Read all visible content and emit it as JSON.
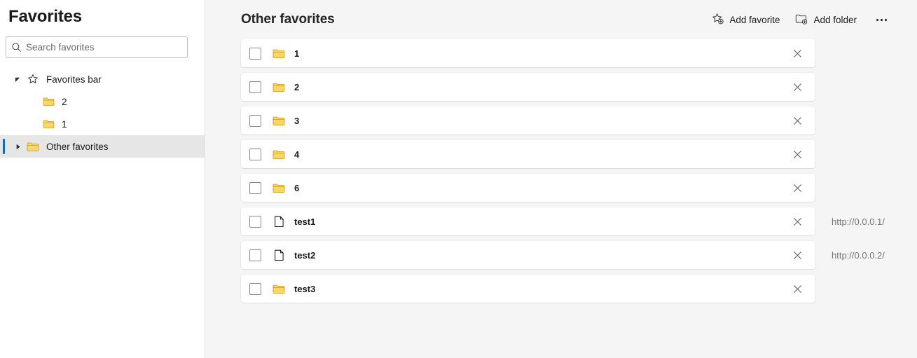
{
  "sidebar": {
    "title": "Favorites",
    "search": {
      "placeholder": "Search favorites",
      "value": "",
      "icon": "search-icon"
    },
    "tree": [
      {
        "label": "Favorites bar",
        "icon": "star-icon",
        "twisty": "expanded",
        "level": 0,
        "selected": false
      },
      {
        "label": "2",
        "icon": "folder-icon",
        "twisty": "none",
        "level": 1,
        "selected": false
      },
      {
        "label": "1",
        "icon": "folder-icon",
        "twisty": "none",
        "level": 1,
        "selected": false
      },
      {
        "label": "Other favorites",
        "icon": "folder-icon",
        "twisty": "collapsed",
        "level": 0,
        "selected": true
      }
    ]
  },
  "main": {
    "title": "Other favorites",
    "toolbar": {
      "add_favorite_label": "Add favorite",
      "add_favorite_icon": "star-plus-icon",
      "add_folder_label": "Add folder",
      "add_folder_icon": "folder-plus-icon",
      "more_icon": "ellipsis-icon"
    },
    "rows": [
      {
        "name": "1",
        "icon": "folder-icon",
        "url": "",
        "checked": false
      },
      {
        "name": "2",
        "icon": "folder-icon",
        "url": "",
        "checked": false
      },
      {
        "name": "3",
        "icon": "folder-icon",
        "url": "",
        "checked": false
      },
      {
        "name": "4",
        "icon": "folder-icon",
        "url": "",
        "checked": false
      },
      {
        "name": "6",
        "icon": "folder-icon",
        "url": "",
        "checked": false
      },
      {
        "name": "test1",
        "icon": "document-icon",
        "url": "http://0.0.0.1/",
        "checked": false
      },
      {
        "name": "test2",
        "icon": "document-icon",
        "url": "http://0.0.0.2/",
        "checked": false
      },
      {
        "name": "test3",
        "icon": "folder-icon",
        "url": "",
        "checked": false
      }
    ],
    "row_close_icon": "close-icon"
  },
  "colors": {
    "accent": "#0f6cbd",
    "folder": "#f5c842",
    "page_bg": "#f5f5f5",
    "sidebar_bg": "#ffffff",
    "selected_bg": "#e6e6e6"
  }
}
